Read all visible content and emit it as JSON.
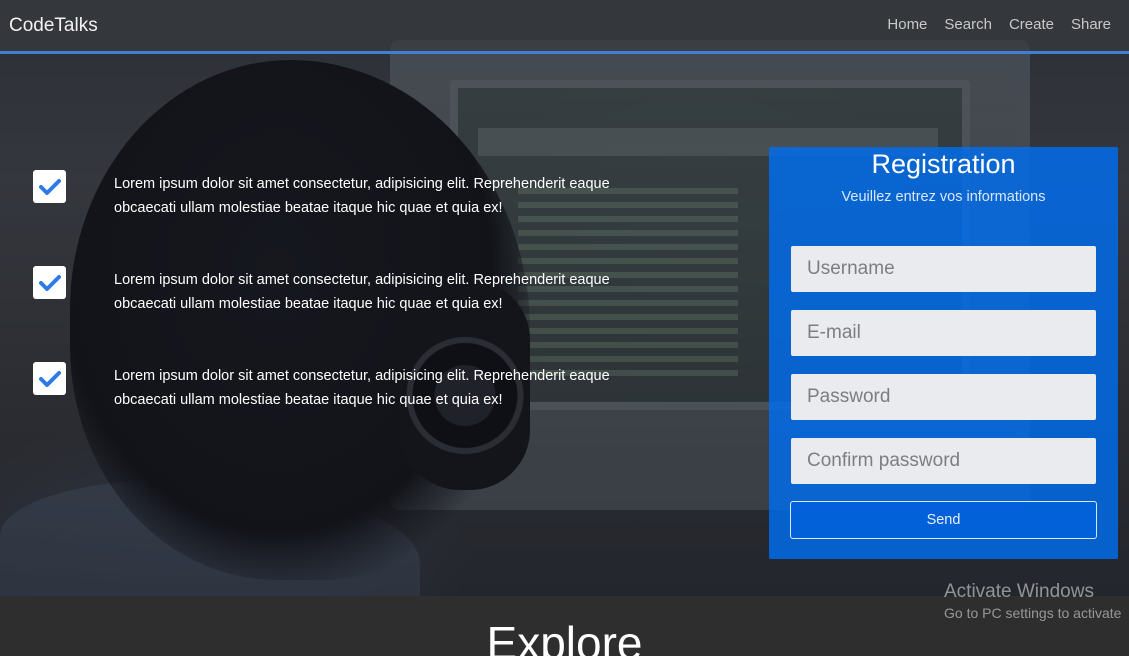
{
  "navbar": {
    "brand": "CodeTalks",
    "links": [
      "Home",
      "Search",
      "Create",
      "Share"
    ],
    "accent": "#3f7fd6"
  },
  "features": [
    {
      "icon": "checkbox-checked-icon",
      "text": "Lorem ipsum dolor sit amet consectetur, adipisicing elit. Reprehenderit eaque obcaecati ullam molestiae beatae itaque hic quae et quia ex!"
    },
    {
      "icon": "checkbox-checked-icon",
      "text": "Lorem ipsum dolor sit amet consectetur, adipisicing elit. Reprehenderit eaque obcaecati ullam molestiae beatae itaque hic quae et quia ex!"
    },
    {
      "icon": "checkbox-checked-icon",
      "text": "Lorem ipsum dolor sit amet consectetur, adipisicing elit. Reprehenderit eaque obcaecati ullam molestiae beatae itaque hic quae et quia ex!"
    }
  ],
  "registration": {
    "title": "Registration",
    "subtitle": "Veuillez entrez vos informations",
    "fields": [
      {
        "name": "username",
        "value": "",
        "placeholder": "Username"
      },
      {
        "name": "email",
        "value": "",
        "placeholder": "E-mail"
      },
      {
        "name": "password",
        "value": "",
        "placeholder": "Password"
      },
      {
        "name": "confirm",
        "value": "",
        "placeholder": "Confirm password"
      }
    ],
    "send_label": "Send",
    "panel_color": "#006ef0"
  },
  "explore": {
    "heading": "Explore"
  },
  "watermark": {
    "line1": "Activate Windows",
    "line2": "Go to PC settings to activate"
  }
}
